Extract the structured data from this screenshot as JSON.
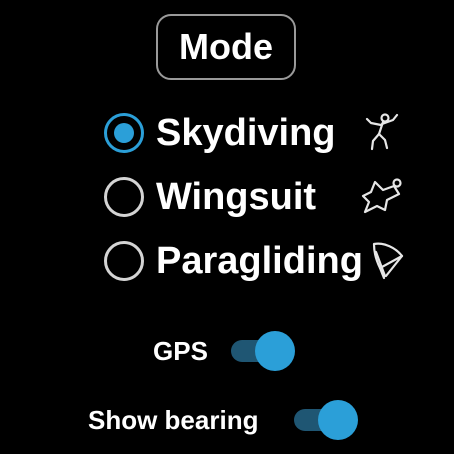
{
  "header": {
    "mode_label": "Mode"
  },
  "modes": {
    "options": [
      {
        "label": "Skydiving",
        "selected": true,
        "icon": "skydiver-icon"
      },
      {
        "label": "Wingsuit",
        "selected": false,
        "icon": "wingsuit-icon"
      },
      {
        "label": "Paragliding",
        "selected": false,
        "icon": "paraglider-icon"
      }
    ]
  },
  "settings": {
    "gps": {
      "label": "GPS",
      "enabled": true
    },
    "bearing": {
      "label": "Show bearing",
      "enabled": true
    }
  },
  "colors": {
    "accent": "#2b9fd8",
    "track": "#1f5673",
    "background": "#000000",
    "radio_unselected": "#d4d4d4",
    "border": "#9a9a9a"
  }
}
